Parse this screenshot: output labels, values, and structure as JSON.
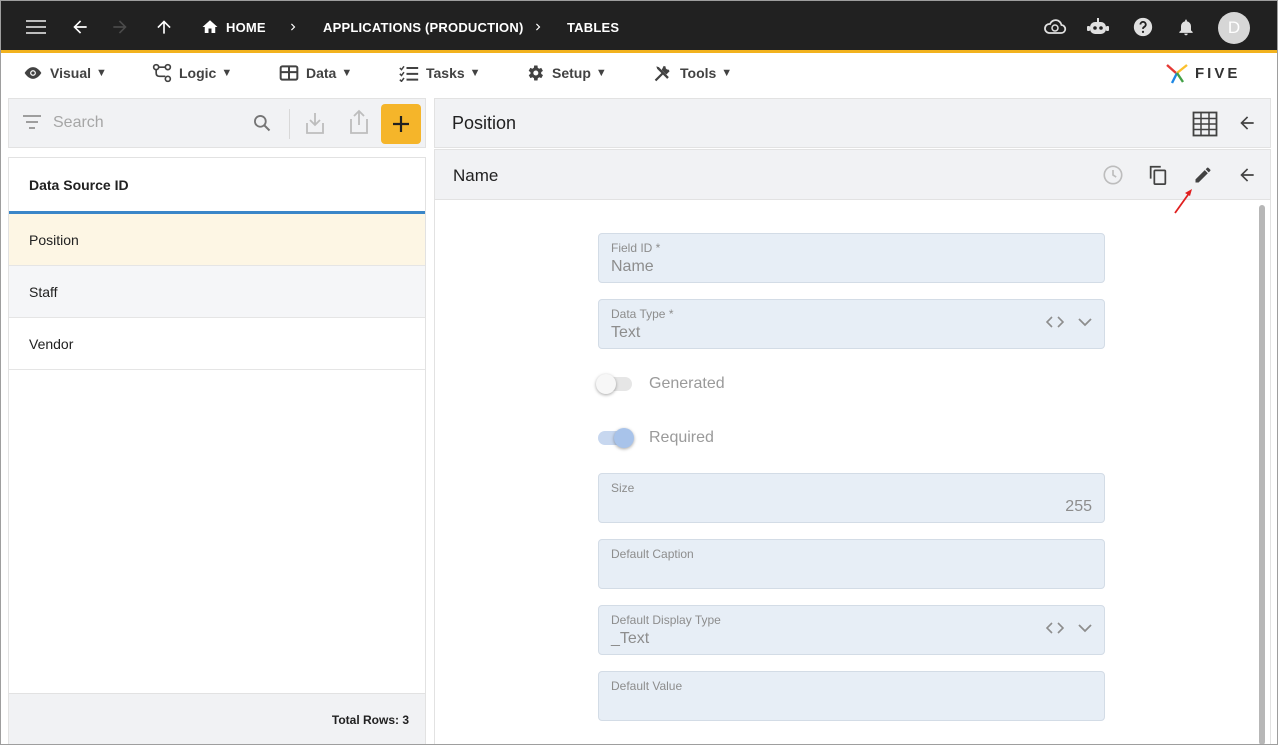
{
  "topbar": {
    "breadcrumbs": [
      {
        "label": "HOME"
      },
      {
        "label": "APPLICATIONS (PRODUCTION)"
      },
      {
        "label": "TABLES"
      }
    ],
    "user_initial": "D"
  },
  "menu": {
    "items": [
      {
        "label": "Visual",
        "icon": "eye-icon"
      },
      {
        "label": "Logic",
        "icon": "logic-icon"
      },
      {
        "label": "Data",
        "icon": "table-icon"
      },
      {
        "label": "Tasks",
        "icon": "tasks-icon"
      },
      {
        "label": "Setup",
        "icon": "gear-icon"
      },
      {
        "label": "Tools",
        "icon": "tools-icon"
      }
    ],
    "caret": "▼",
    "logo_text": "FIVE"
  },
  "left": {
    "search_placeholder": "Search",
    "column_header": "Data Source ID",
    "rows": [
      "Position",
      "Staff",
      "Vendor"
    ],
    "footer": "Total Rows: 3"
  },
  "right": {
    "outer_title": "Position",
    "inner_title": "Name",
    "fields": {
      "field_id": {
        "label": "Field ID *",
        "value": "Name"
      },
      "data_type": {
        "label": "Data Type *",
        "value": "Text"
      },
      "generated": {
        "label": "Generated",
        "on": false
      },
      "required": {
        "label": "Required",
        "on": true
      },
      "size": {
        "label": "Size",
        "value": "255"
      },
      "default_caption": {
        "label": "Default Caption",
        "value": ""
      },
      "default_display_type": {
        "label": "Default Display Type",
        "value": "_Text"
      },
      "default_value": {
        "label": "Default Value",
        "value": ""
      }
    }
  },
  "colors": {
    "accent": "#f5b52a",
    "topbar": "#212121",
    "selected_row": "#fdf6e4",
    "header_underline": "#3a86c8",
    "field_bg": "#e7eef6",
    "annotation_arrow": "#e02020"
  }
}
